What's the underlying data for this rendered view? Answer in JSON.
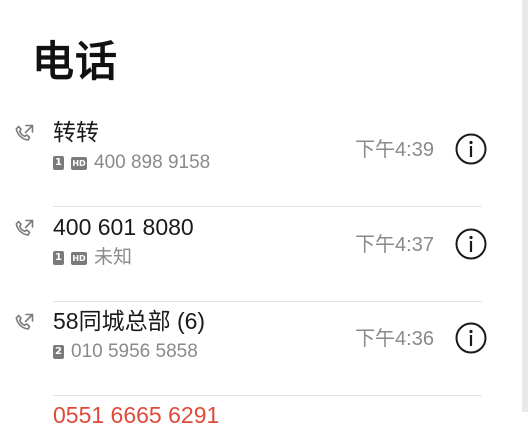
{
  "page": {
    "title": "电话"
  },
  "calls": [
    {
      "name": "转转",
      "sim": "1",
      "hd": "HD",
      "subtext": "400 898 9158",
      "time": "下午4:39"
    },
    {
      "name": "400 601 8080",
      "sim": "1",
      "hd": "HD",
      "subtext": "未知",
      "time": "下午4:37"
    },
    {
      "name": "58同城总部 (6)",
      "sim": "2",
      "hd": "",
      "subtext": "010 5956 5858",
      "time": "下午4:36"
    }
  ],
  "partial_row": {
    "name": "0551 6665 6291"
  },
  "colors": {
    "missed": "#e04a3a",
    "secondary_text": "#8a8a8a"
  },
  "icons": {
    "call_type": "outgoing-call-icon",
    "details": "info-icon"
  }
}
